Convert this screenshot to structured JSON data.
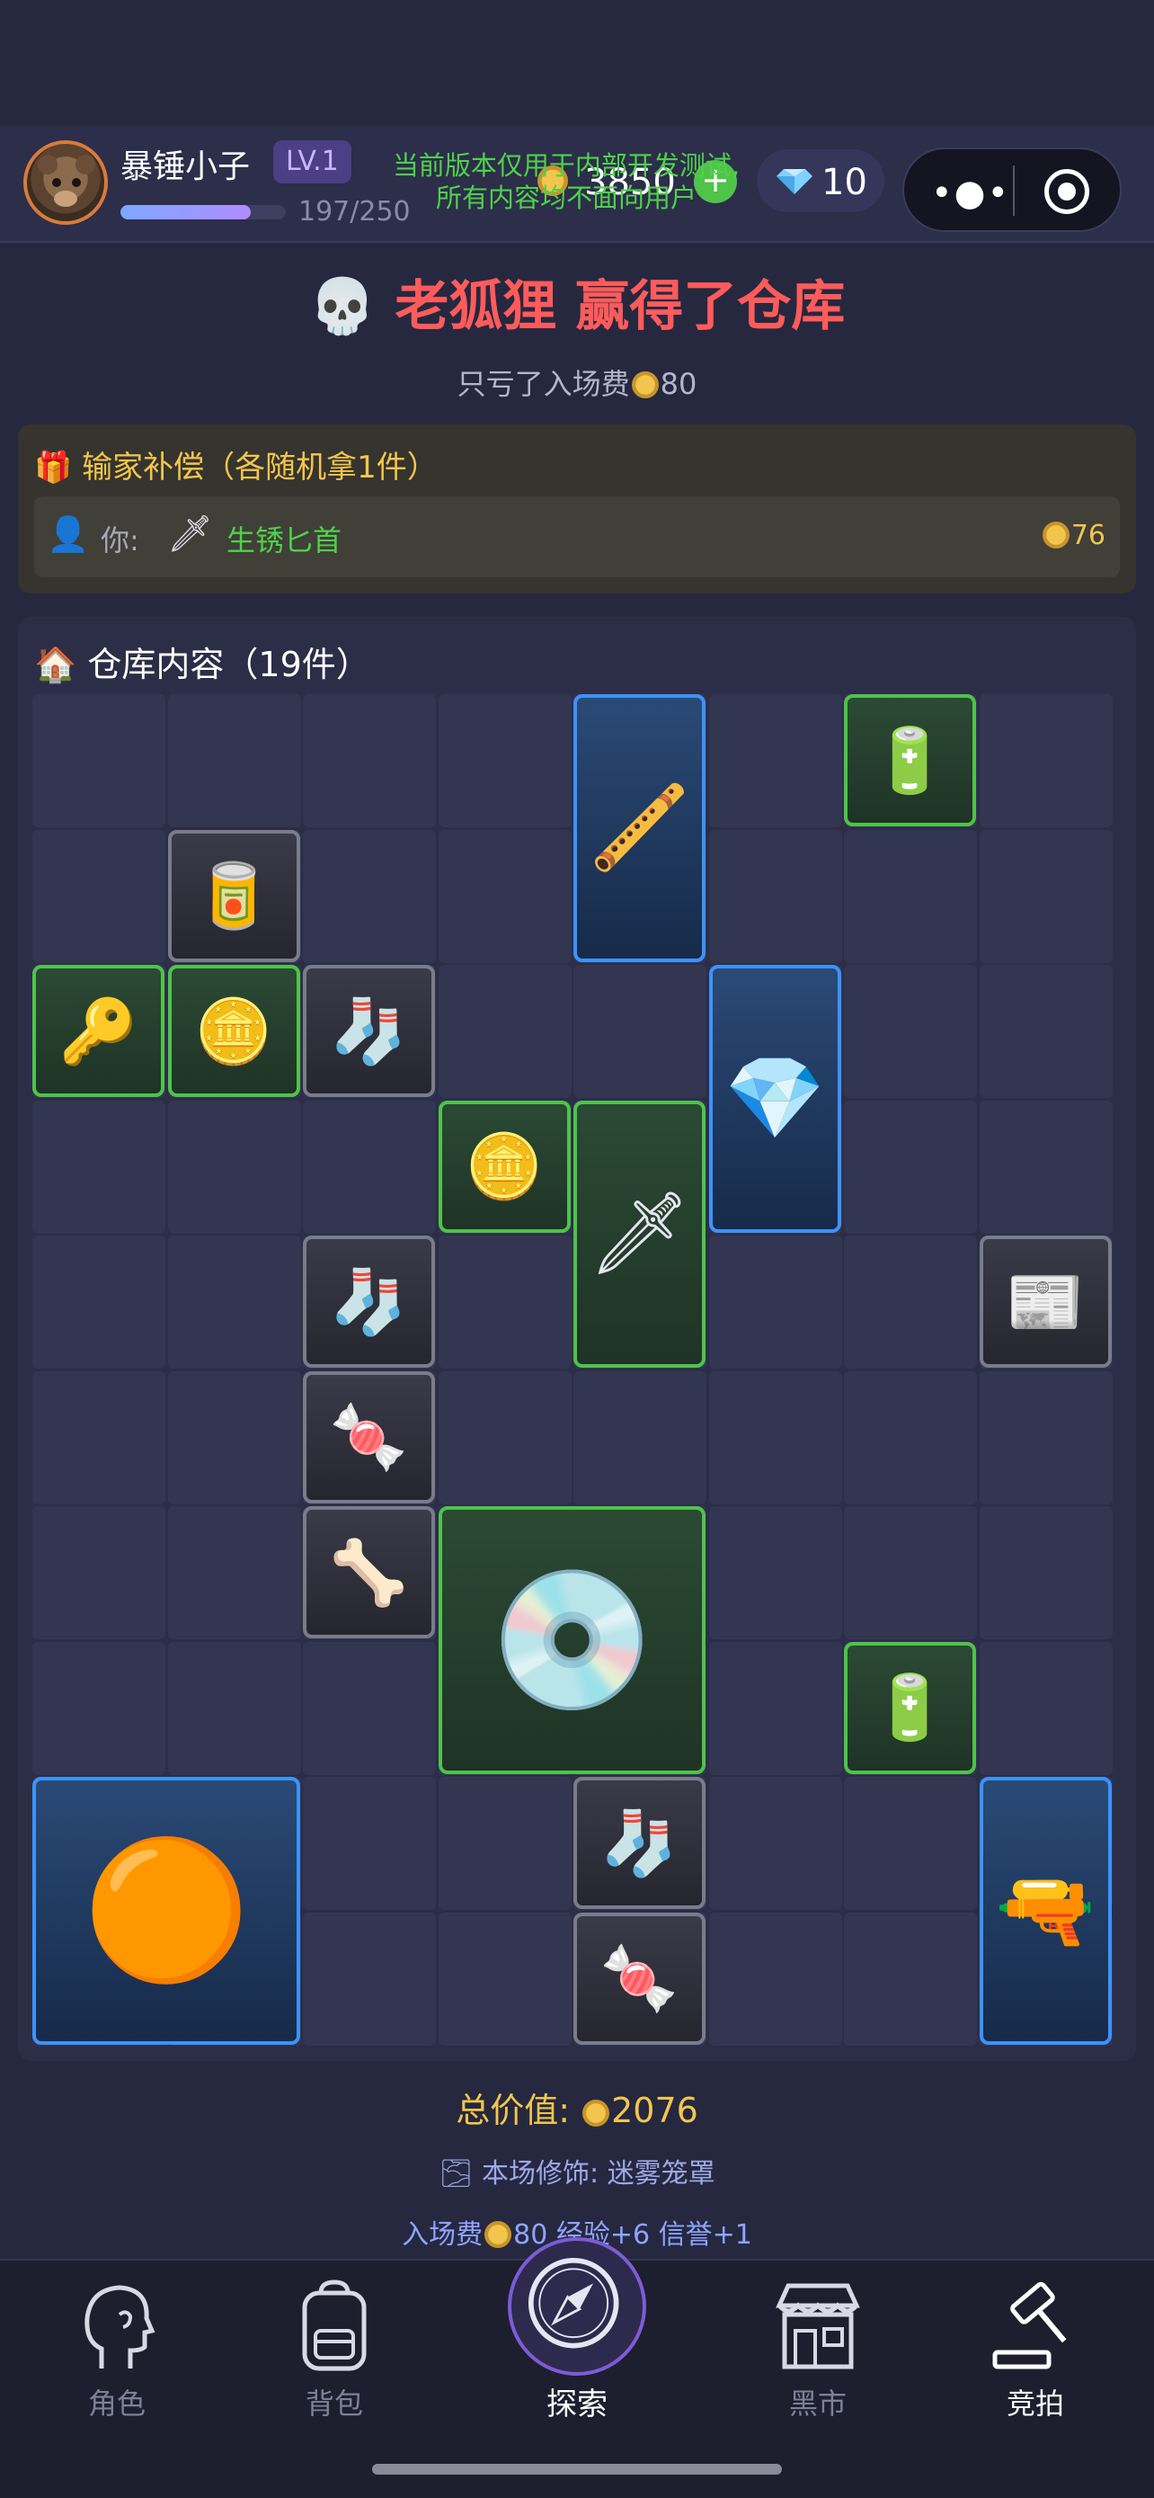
{
  "header": {
    "player_name": "暴锤小子",
    "level": "LV.1",
    "exp_text": "197/250",
    "exp_progress": 0.788,
    "notice_line1": "当前版本仅用于内部开发测试,",
    "notice_line2": "所有内容均不面向用户",
    "coins": "3850",
    "coin_add": "+",
    "gems": "10",
    "capsule_more": "•●•"
  },
  "result": {
    "title": "老狐狸 赢得了仓库",
    "skull_icon": "💀",
    "sub_prefix": "只亏了入场费",
    "sub_amount": "80"
  },
  "compensation": {
    "title": "输家补偿（各随机拿1件）",
    "gift_icon": "🎁",
    "you_label": "你:",
    "user_icon": "👤",
    "item_icon": "🗡",
    "item_name": "生锈匕首",
    "item_value": "76"
  },
  "warehouse": {
    "title": "仓库内容（19件）",
    "house_icon": "🏠",
    "items": [
      {
        "name": "pipe",
        "glyph": "🪈",
        "rarity": "blue",
        "col": 4,
        "row": 0,
        "w": 1,
        "h": 2
      },
      {
        "name": "battery",
        "glyph": "🔋",
        "rarity": "green",
        "col": 6,
        "row": 0,
        "w": 1,
        "h": 1
      },
      {
        "name": "tin-can",
        "glyph": "🥫",
        "rarity": "gray",
        "col": 1,
        "row": 1,
        "w": 1,
        "h": 1
      },
      {
        "name": "keychain",
        "glyph": "🔑",
        "rarity": "green",
        "col": 0,
        "row": 2,
        "w": 1,
        "h": 1
      },
      {
        "name": "coin",
        "glyph": "🪙",
        "rarity": "green",
        "col": 1,
        "row": 2,
        "w": 1,
        "h": 1
      },
      {
        "name": "sock",
        "glyph": "🧦",
        "rarity": "gray",
        "col": 2,
        "row": 2,
        "w": 1,
        "h": 1
      },
      {
        "name": "crystal",
        "glyph": "💎",
        "rarity": "blue",
        "col": 5,
        "row": 2,
        "w": 1,
        "h": 2
      },
      {
        "name": "coin",
        "glyph": "🪙",
        "rarity": "green",
        "col": 3,
        "row": 3,
        "w": 1,
        "h": 1
      },
      {
        "name": "dagger",
        "glyph": "🗡",
        "rarity": "green",
        "col": 4,
        "row": 3,
        "w": 1,
        "h": 2
      },
      {
        "name": "sock",
        "glyph": "🧦",
        "rarity": "gray",
        "col": 2,
        "row": 4,
        "w": 1,
        "h": 1
      },
      {
        "name": "newspaper",
        "glyph": "📰",
        "rarity": "gray",
        "col": 7,
        "row": 4,
        "w": 1,
        "h": 1
      },
      {
        "name": "candy",
        "glyph": "🍬",
        "rarity": "gray",
        "col": 2,
        "row": 5,
        "w": 1,
        "h": 1
      },
      {
        "name": "bone",
        "glyph": "🦴",
        "rarity": "gray",
        "col": 2,
        "row": 6,
        "w": 1,
        "h": 1
      },
      {
        "name": "vinyl-record",
        "glyph": "💿",
        "rarity": "green",
        "col": 3,
        "row": 6,
        "w": 2,
        "h": 2
      },
      {
        "name": "battery",
        "glyph": "🔋",
        "rarity": "green",
        "col": 6,
        "row": 7,
        "w": 1,
        "h": 1
      },
      {
        "name": "amber",
        "glyph": "🟠",
        "rarity": "blue",
        "col": 0,
        "row": 8,
        "w": 2,
        "h": 2
      },
      {
        "name": "sock",
        "glyph": "🧦",
        "rarity": "gray",
        "col": 4,
        "row": 8,
        "w": 1,
        "h": 1
      },
      {
        "name": "blaster",
        "glyph": "🔫",
        "rarity": "blue",
        "col": 7,
        "row": 8,
        "w": 1,
        "h": 2
      },
      {
        "name": "candy",
        "glyph": "🍬",
        "rarity": "gray",
        "col": 4,
        "row": 9,
        "w": 1,
        "h": 1
      }
    ]
  },
  "summary": {
    "total_label": "总价值:",
    "total_value": "2076",
    "decor_icon": "🌫",
    "decor_text": "本场修饰: 迷雾笼罩",
    "entry_label": "入场费",
    "entry_fee": "80",
    "entry_rest": "经验+6  信誉+1"
  },
  "nav": {
    "role": "角色",
    "backpack": "背包",
    "explore": "探索",
    "market": "黑市",
    "auction": "竞拍"
  },
  "colors": {
    "accent_red": "#ff5b5b",
    "gold": "#f2c64c",
    "green_rarity": "#4fc34a",
    "blue_rarity": "#3b93ff",
    "gray_rarity": "#7a7c8a",
    "notice_green": "#4fd14a"
  }
}
